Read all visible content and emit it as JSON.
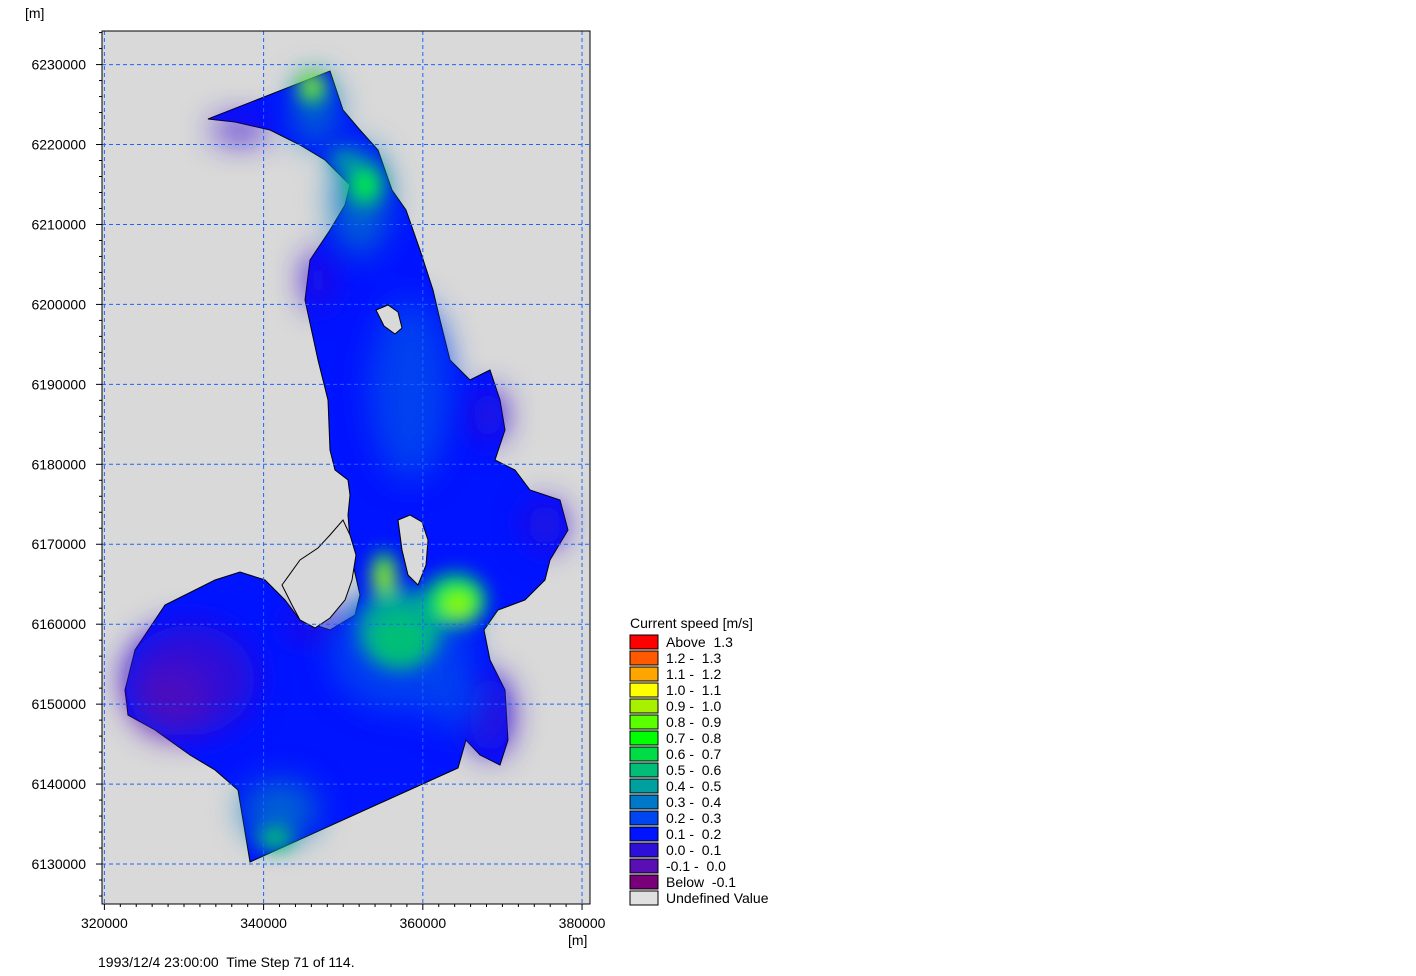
{
  "chart_data": {
    "type": "heatmap",
    "unit_top": "[m]",
    "unit_bottom": "[m]",
    "x_ticks": [
      320000,
      340000,
      360000,
      380000
    ],
    "y_ticks": [
      6130000,
      6140000,
      6150000,
      6160000,
      6170000,
      6180000,
      6190000,
      6200000,
      6210000,
      6220000,
      6230000
    ],
    "xlim": [
      319700,
      381000
    ],
    "ylim": [
      6125000,
      6234200
    ],
    "grid": true,
    "background_color": "#d9d9d9",
    "legend_placement": "bottom-right",
    "legend_title": "Current speed [m/s]",
    "legend": [
      {
        "label": "Above  1.3",
        "color": "#ff0000"
      },
      {
        "label": "1.2 -  1.3",
        "color": "#ff5a00"
      },
      {
        "label": "1.1 -  1.2",
        "color": "#ffa500"
      },
      {
        "label": "1.0 -  1.1",
        "color": "#ffff00"
      },
      {
        "label": "0.9 -  1.0",
        "color": "#a8f000"
      },
      {
        "label": "0.8 -  0.9",
        "color": "#5aff00"
      },
      {
        "label": "0.7 -  0.8",
        "color": "#00ff00"
      },
      {
        "label": "0.6 -  0.7",
        "color": "#00dc46"
      },
      {
        "label": "0.5 -  0.6",
        "color": "#00be78"
      },
      {
        "label": "0.4 -  0.5",
        "color": "#00a0a0"
      },
      {
        "label": "0.3 -  0.4",
        "color": "#0078c8"
      },
      {
        "label": "0.2 -  0.3",
        "color": "#0046f0"
      },
      {
        "label": "0.1 -  0.2",
        "color": "#0014ff"
      },
      {
        "label": "0.0 -  0.1",
        "color": "#2d0fd7"
      },
      {
        "label": "-0.1 -  0.0",
        "color": "#5a0fb4"
      },
      {
        "label": "Below  -0.1",
        "color": "#780078"
      },
      {
        "label": "Undefined Value",
        "color": "#e0e0e0"
      }
    ],
    "footer": "1993/12/4 23:00:00  Time Step 71 of 114."
  }
}
